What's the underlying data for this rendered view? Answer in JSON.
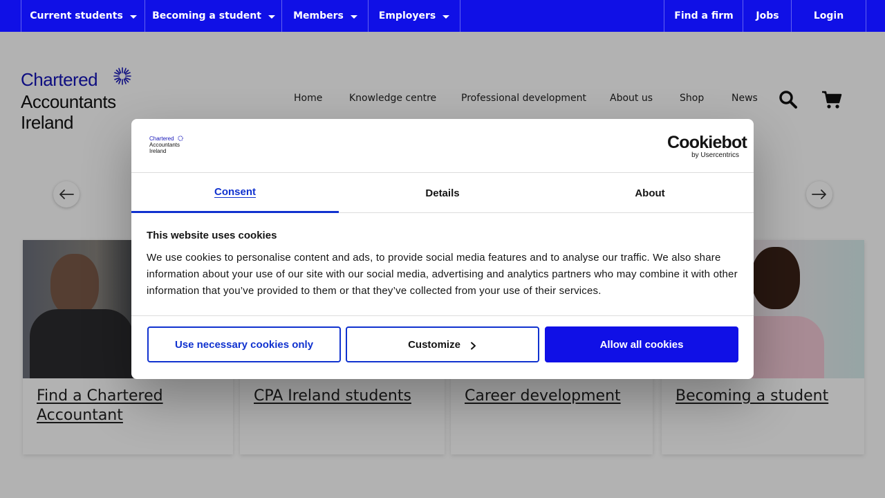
{
  "topbar": {
    "left_items": [
      "Current students",
      "Becoming a student",
      "Members",
      "Employers"
    ],
    "right_items": [
      "Find a firm",
      "Jobs",
      "Login"
    ]
  },
  "logo": {
    "line1": "Chartered",
    "line2": "Accountants",
    "line3": "Ireland"
  },
  "main_nav": {
    "items": [
      "Home",
      "Knowledge centre",
      "Professional development",
      "About us",
      "Shop",
      "News"
    ],
    "search_icon": "search-icon",
    "cart_icon": "cart-icon"
  },
  "carousel": {
    "prev_icon": "arrow-left-icon",
    "next_icon": "arrow-right-icon"
  },
  "cards": [
    {
      "title": "Find a Chartered Accountant"
    },
    {
      "title": "CPA Ireland students"
    },
    {
      "title": "Career development"
    },
    {
      "title": "Becoming a student"
    }
  ],
  "cookie_dialog": {
    "logo": {
      "line1": "Chartered",
      "line2": "Accountants",
      "line3": "Ireland"
    },
    "brand": {
      "name": "Cookiebot",
      "sub": "by Usercentrics"
    },
    "tabs": [
      "Consent",
      "Details",
      "About"
    ],
    "active_tab": "Consent",
    "heading": "This website uses cookies",
    "body": "We use cookies to personalise content and ads, to provide social media features and to analyse our traffic. We also share information about your use of our site with our social media, advertising and analytics partners who may combine it with other information that you’ve provided to them or that they’ve collected from your use of their services.",
    "buttons": {
      "necessary": "Use necessary cookies only",
      "customize": "Customize",
      "allow_all": "Allow all cookies"
    }
  },
  "colors": {
    "brand_blue": "#1010e6",
    "dialog_accent": "#1032cf"
  }
}
